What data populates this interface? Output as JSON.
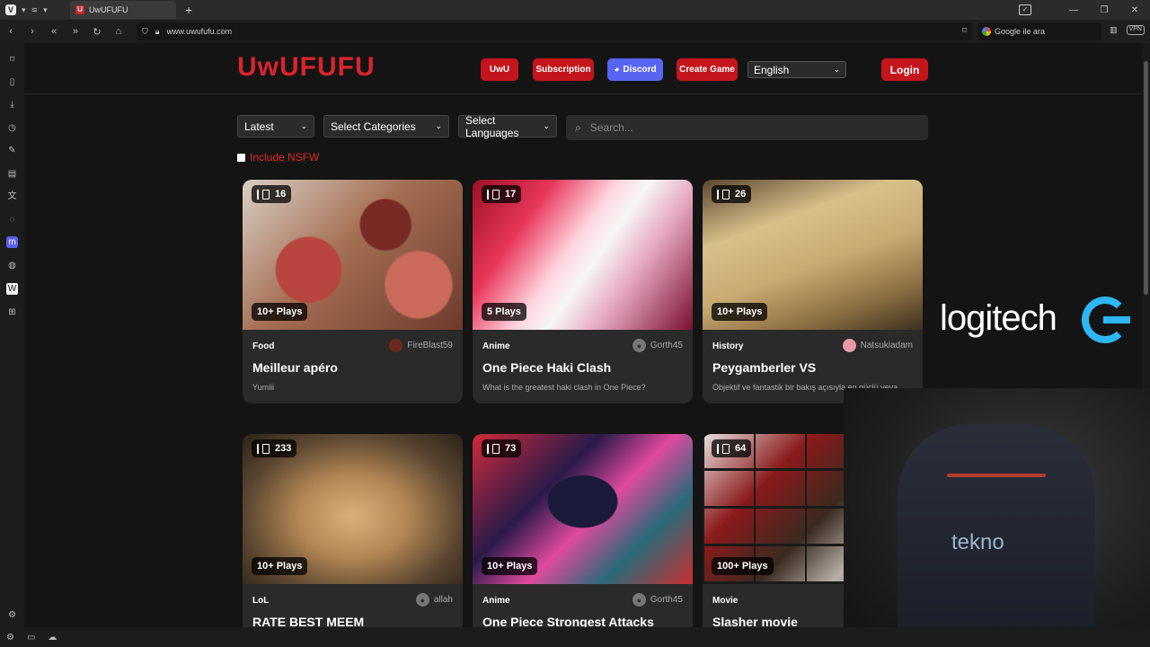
{
  "browser": {
    "tab_title": "UwUFUFU",
    "tab_favicon": "U",
    "new_tab": "+",
    "url": "www.uwufufu.com",
    "search_placeholder": "Google ile ara",
    "vpn_label": "VPN"
  },
  "site": {
    "logo": "UwUFUFU",
    "nav": {
      "uwu": "UwU",
      "subscription": "Subscription",
      "discord": "Discord",
      "create_game": "Create Game",
      "language": "English",
      "login": "Login"
    },
    "filters": {
      "sort": "Latest",
      "categories": "Select Categories",
      "languages": "Select Languages",
      "search_placeholder": "Search..."
    },
    "nsfw_label": "Include NSFW",
    "cards": [
      {
        "count": "16",
        "plays": "10+ Plays",
        "category": "Food",
        "author": "FireBlast59",
        "title": "Meilleur apéro",
        "desc": "Yumiii"
      },
      {
        "count": "17",
        "plays": "5 Plays",
        "category": "Anime",
        "author": "Gorth45",
        "title": "One Piece Haki Clash",
        "desc": "What is the greatest haki clash in One Piece?"
      },
      {
        "count": "26",
        "plays": "10+ Plays",
        "category": "History",
        "author": "Natsukiadam",
        "title": "Peygamberler VS",
        "desc": "Objektif ve fantastik bir bakış açısıyla en güçlü veya"
      },
      {
        "count": "233",
        "plays": "10+ Plays",
        "category": "LoL",
        "author": "allah",
        "title": "RATE BEST MEEM",
        "desc": ""
      },
      {
        "count": "73",
        "plays": "10+ Plays",
        "category": "Anime",
        "author": "Gorth45",
        "title": "One Piece Strongest Attacks",
        "desc": ""
      },
      {
        "count": "64",
        "plays": "100+ Plays",
        "category": "Movie",
        "author": "",
        "title": "Slasher movie",
        "desc": ""
      }
    ]
  },
  "overlay": {
    "sponsor": "logitech",
    "chair_text": "tekno"
  },
  "colors": {
    "brand_red": "#d9242d",
    "discord": "#5865f2",
    "nsfw_red": "#e02a2a"
  }
}
